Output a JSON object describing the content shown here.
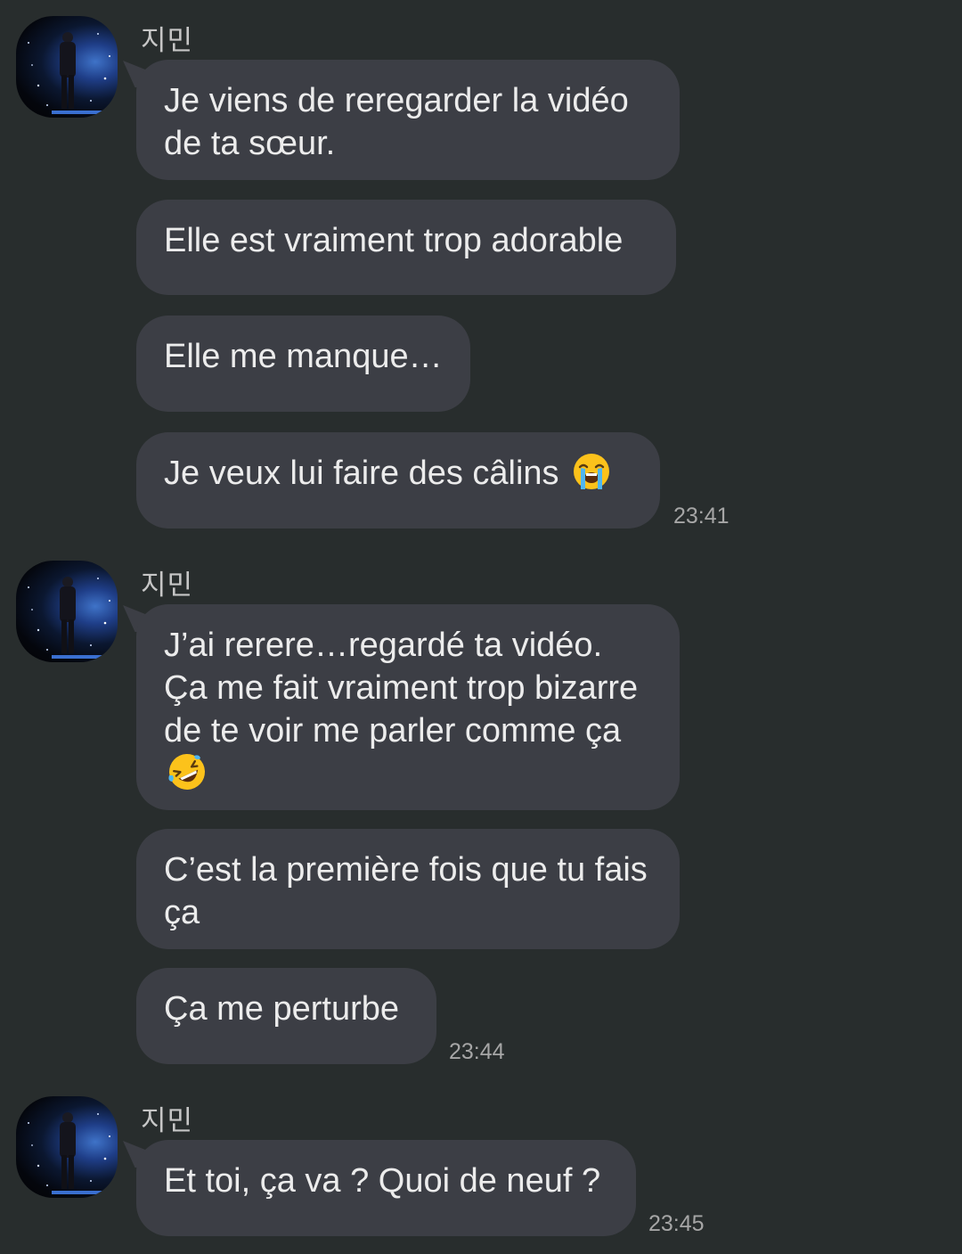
{
  "conversation": {
    "groups": [
      {
        "sender": "지민",
        "messages": [
          "Je viens de reregarder la vidéo de ta sœur.",
          "Elle est vraiment trop adorable",
          "Elle me manque…",
          "Je veux lui faire des câlins"
        ],
        "time": "23:41"
      },
      {
        "sender": "지민",
        "messages": [
          "J’ai rerere…regardé ta vidéo. Ça me fait vraiment trop bizarre de te voir me parler comme ça",
          "C’est la première fois que tu fais ça",
          "Ça me perturbe"
        ],
        "time": "23:44"
      },
      {
        "sender": "지민",
        "messages": [
          "Et toi, ça va ? Quoi de neuf ?"
        ],
        "time": "23:45"
      }
    ],
    "emojis": {
      "crying": "loudly-crying-face-icon",
      "laughing": "rolling-on-floor-laughing-icon"
    },
    "colors": {
      "background": "#282d2d",
      "bubble": "#3c3e45",
      "text": "#ececec",
      "timestamp": "#a6a6a6"
    }
  }
}
